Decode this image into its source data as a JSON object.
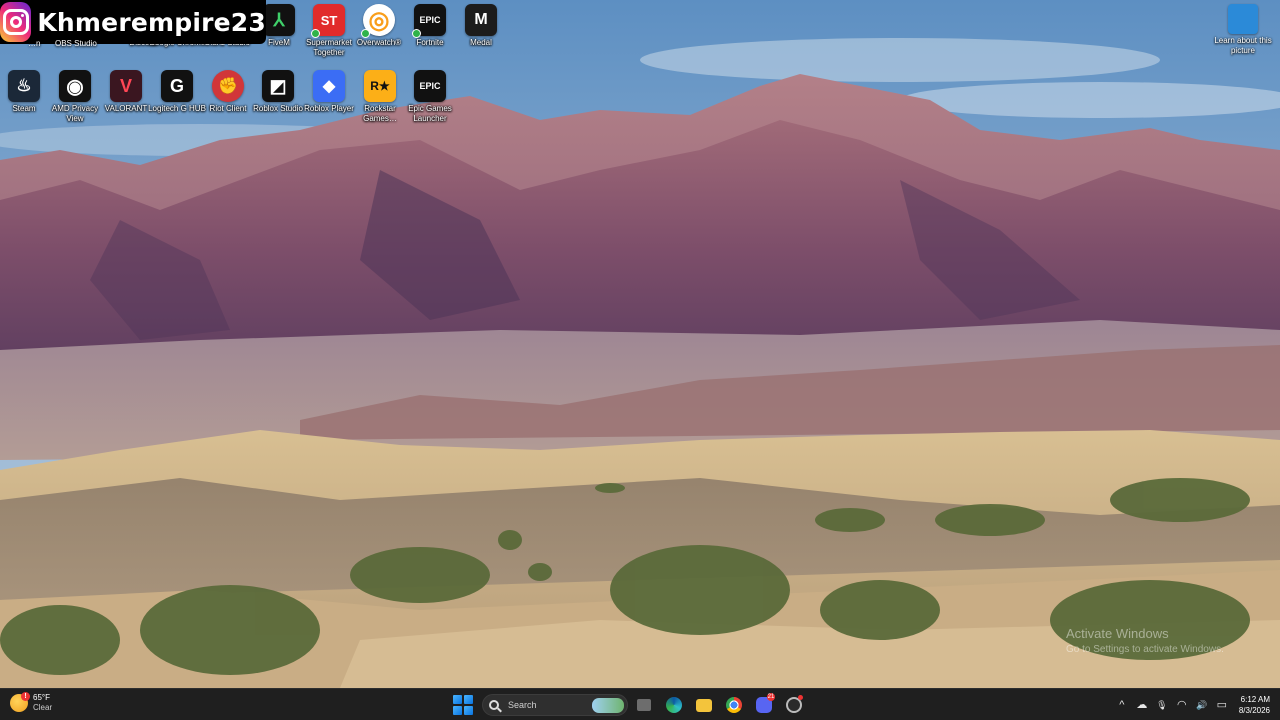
{
  "overlay": {
    "streamer_name": "Khmerempire23",
    "platform_icon": "instagram-icon"
  },
  "desktop": {
    "row1": [
      {
        "label": "…n",
        "icon": "hidden-app-icon"
      },
      {
        "label": "OBS Studio",
        "icon": "obs-icon"
      },
      {
        "label": "Discord",
        "icon": "discord-icon"
      },
      {
        "label": "Google Chrome",
        "icon": "chrome-icon"
      },
      {
        "label": "Gianz Studio",
        "icon": "gianz-icon"
      },
      {
        "label": "FiveM",
        "icon": "fivem-icon"
      },
      {
        "label": "Supermarket Together",
        "icon": "supermarket-icon"
      },
      {
        "label": "Overwatch®",
        "icon": "overwatch-icon"
      },
      {
        "label": "Fortnite",
        "icon": "fortnite-icon"
      },
      {
        "label": "Medal",
        "icon": "medal-icon"
      }
    ],
    "row2": [
      {
        "label": "Steam",
        "icon": "steam-icon"
      },
      {
        "label": "AMD Privacy View",
        "icon": "amd-privacy-icon"
      },
      {
        "label": "VALORANT",
        "icon": "valorant-icon"
      },
      {
        "label": "Logitech G HUB",
        "icon": "logitech-icon"
      },
      {
        "label": "Riot Client",
        "icon": "riot-icon"
      },
      {
        "label": "Roblox Studio",
        "icon": "roblox-studio-icon"
      },
      {
        "label": "Roblox Player",
        "icon": "roblox-player-icon"
      },
      {
        "label": "Rockstar Games…",
        "icon": "rockstar-icon"
      },
      {
        "label": "Epic Games Launcher",
        "icon": "epic-games-icon"
      }
    ],
    "glyphs": {
      "fivem": "⅄",
      "supermarket": "ST",
      "overwatch": "◎",
      "fortnite": "EPIC",
      "medal": "M",
      "steam": "♨",
      "amd": "◉",
      "valorant": "V",
      "logitech": "G",
      "riot": "✊",
      "roblox_studio": "◩",
      "roblox_player": "◆",
      "rockstar": "R★",
      "epic": "EPIC"
    },
    "learn_label": "Learn about this picture"
  },
  "watermark": {
    "title": "Activate Windows",
    "subtitle": "Go to Settings to activate Windows."
  },
  "taskbar": {
    "weather_temp": "65°F",
    "weather_cond": "Clear",
    "weather_alert": "!",
    "search_placeholder": "Search",
    "discord_badge": "21",
    "time": "6:12 AM",
    "date": "8/3/2026",
    "tray_glyphs": {
      "chevron": "^",
      "cloud": "☁",
      "mic": "🎙",
      "wifi": "◠",
      "volume": "🔊",
      "battery": "▭"
    }
  },
  "colors": {
    "taskbar_bg": "#1f1f1f",
    "sky_top": "#5d8fc2",
    "mountain": "#8a5a72",
    "sand": "#c9b089"
  }
}
